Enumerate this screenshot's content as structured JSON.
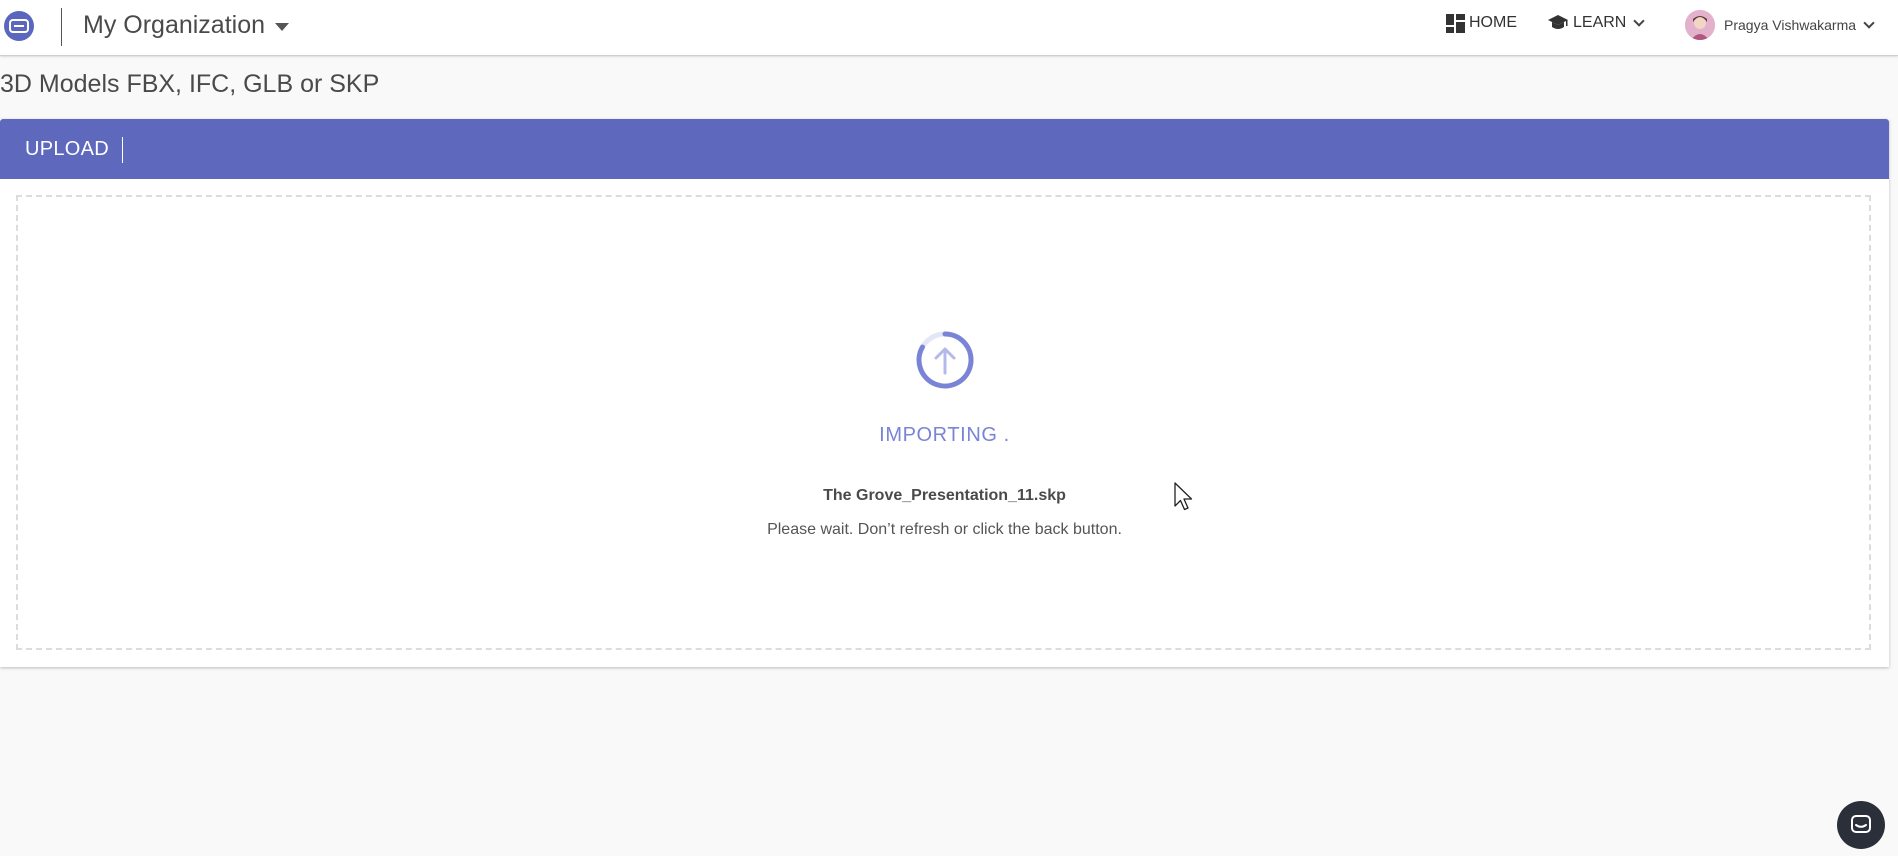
{
  "header": {
    "org_name": "My Organization",
    "nav": {
      "home_label": "HOME",
      "learn_label": "LEARN",
      "user_name": "Pragya Vishwakarma"
    }
  },
  "page": {
    "title": "3D Models FBX, IFC, GLB or SKP"
  },
  "upload_card": {
    "tab_label": "UPLOAD",
    "status": "IMPORTING .",
    "file_name": "The Grove_Presentation_11.skp",
    "hint": "Please wait. Don’t refresh or click the back button."
  },
  "colors": {
    "accent": "#5e68bc",
    "status": "#7a84d6",
    "chat_button": "#2b2f3a"
  },
  "icons": {
    "logo": "logo-icon",
    "home": "grid-icon",
    "learn": "graduation-cap-icon",
    "spinner": "upload-arrow-icon",
    "chat": "chat-icon"
  }
}
